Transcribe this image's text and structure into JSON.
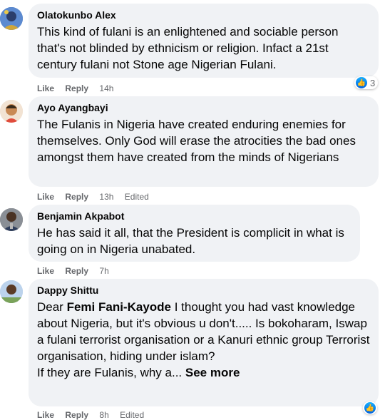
{
  "comments": [
    {
      "author": "Olatokunbo Alex",
      "text": "This kind of fulani is an enlightened and sociable person that's not blinded by ethnicism or religion. Infact a 21st century fulani not Stone age Nigerian Fulani.",
      "like": "Like",
      "reply": "Reply",
      "time": "14h",
      "reaction_count": "3"
    },
    {
      "author": "Ayo Ayangbayi",
      "text": "The Fulanis in Nigeria have created enduring enemies for themselves. Only God will erase the atrocities the bad ones amongst them have created from the minds of Nigerians",
      "like": "Like",
      "reply": "Reply",
      "time": "13h",
      "edited": "Edited"
    },
    {
      "author": "Benjamin Akpabot",
      "text": "He has said it all, that the President is complicit in what is going on in Nigeria unabated.",
      "like": "Like",
      "reply": "Reply",
      "time": "7h"
    },
    {
      "author": "Dappy Shittu",
      "text_prefix": "Dear ",
      "mention": "Femi Fani-Kayode",
      "text": " I thought you had vast knowledge about Nigeria, but it's obvious u don't..... Is bokoharam, Iswap a fulani terrorist organisation or a Kanuri ethnic group Terrorist organisation, hiding under islam?",
      "text2": "If they are Fulanis, why a... ",
      "see_more": "See more",
      "like": "Like",
      "reply": "Reply",
      "time": "8h",
      "edited": "Edited"
    }
  ],
  "colors": {
    "bubble": "#f0f2f5",
    "meta_text": "#65676b",
    "like_blue": "#1877f2"
  }
}
